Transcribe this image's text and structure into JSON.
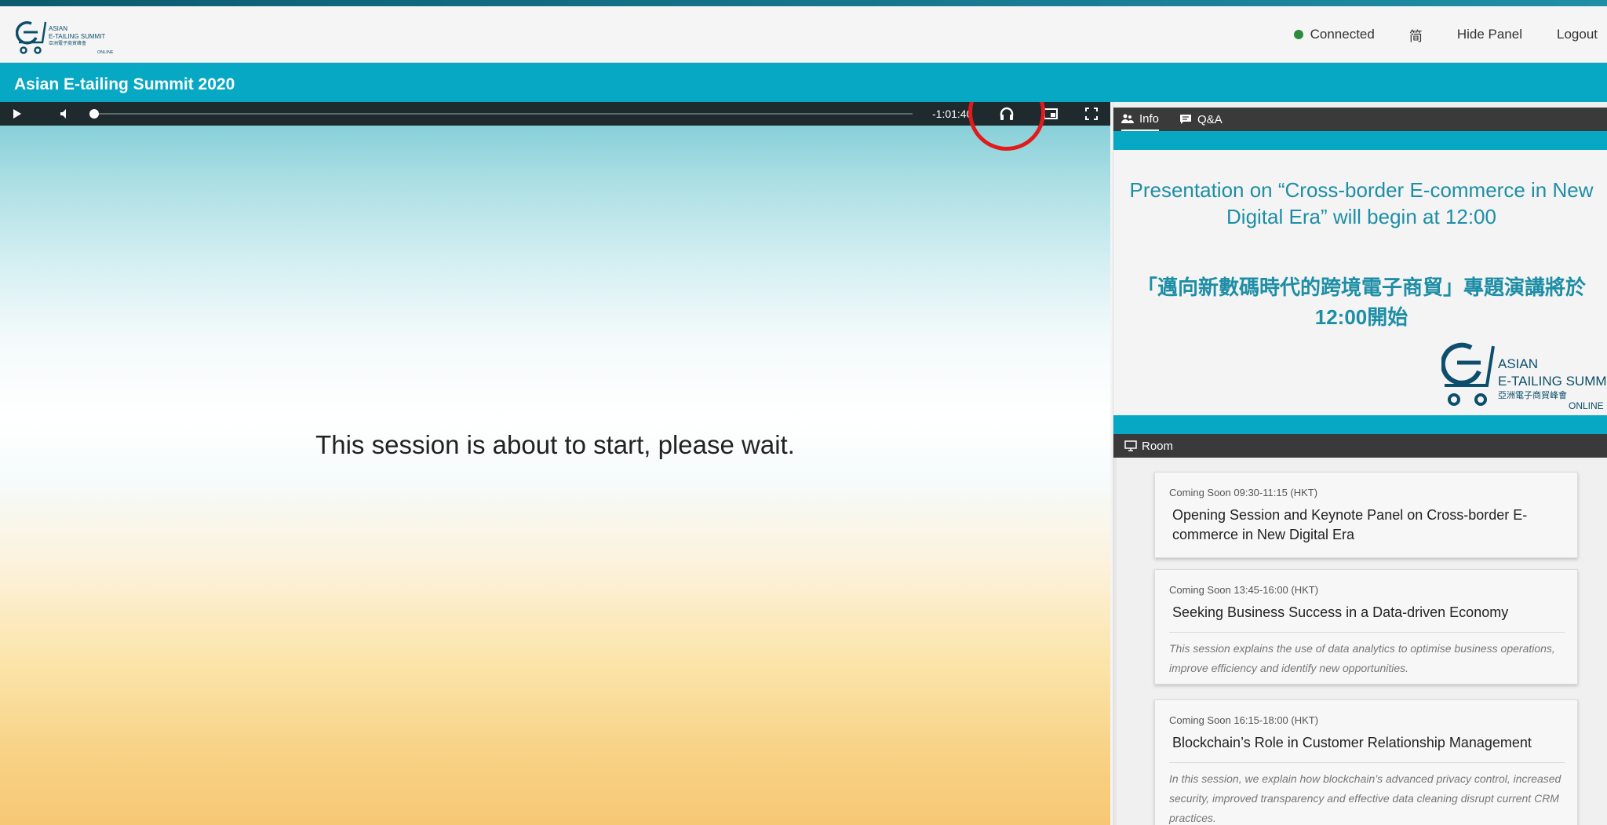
{
  "header": {
    "logo": {
      "line1": "ASIAN",
      "line2": "E-TAILING SUMMIT",
      "line3": "亞洲電子商貿峰會",
      "line4": "ONLINE"
    },
    "status": "Connected",
    "lang_toggle": "简",
    "hide_panel": "Hide Panel",
    "logout": "Logout"
  },
  "event_title": "Asian E-tailing Summit 2020",
  "player": {
    "time_remaining": "-1:01:40",
    "message": "This session is about to start, please wait.",
    "progress_fraction": 0.01
  },
  "panel": {
    "tabs": [
      {
        "label": "Info",
        "icon": "people-icon"
      },
      {
        "label": "Q&A",
        "icon": "chat-icon"
      }
    ],
    "info": {
      "announcement_en": "Presentation on “Cross-border E-commerce in New Digital Era” will begin at 12:00",
      "announcement_zh": "「邁向新數碼時代的跨境電子商貿」專題演講將於12:00開始",
      "logo": {
        "line1": "ASIAN",
        "line2": "E-TAILING SUMMIT",
        "line3": "亞洲電子商貿峰會",
        "line4": "ONLINE"
      }
    },
    "room_label": "Room",
    "sessions": [
      {
        "meta": "Coming Soon  09:30-11:15 (HKT)",
        "title": "Opening Session and Keynote Panel on Cross-border E-commerce in New Digital Era",
        "desc": ""
      },
      {
        "meta": "Coming Soon  13:45-16:00 (HKT)",
        "title": "Seeking Business Success in a Data-driven Economy",
        "desc": "This session explains the use of data analytics to optimise business operations, improve efficiency and identify new opportunities."
      },
      {
        "meta": "Coming Soon  16:15-18:00 (HKT)",
        "title": "Blockchain’s Role in Customer Relationship Management",
        "desc": "In this session, we explain how blockchain’s advanced privacy control, increased security, improved transparency and effective data cleaning disrupt current CRM practices."
      }
    ]
  },
  "colors": {
    "accent": "#06a8c4",
    "dark_bar": "#3a3a3a",
    "highlight": "#e11b1b",
    "connected": "#2d8a3b"
  }
}
